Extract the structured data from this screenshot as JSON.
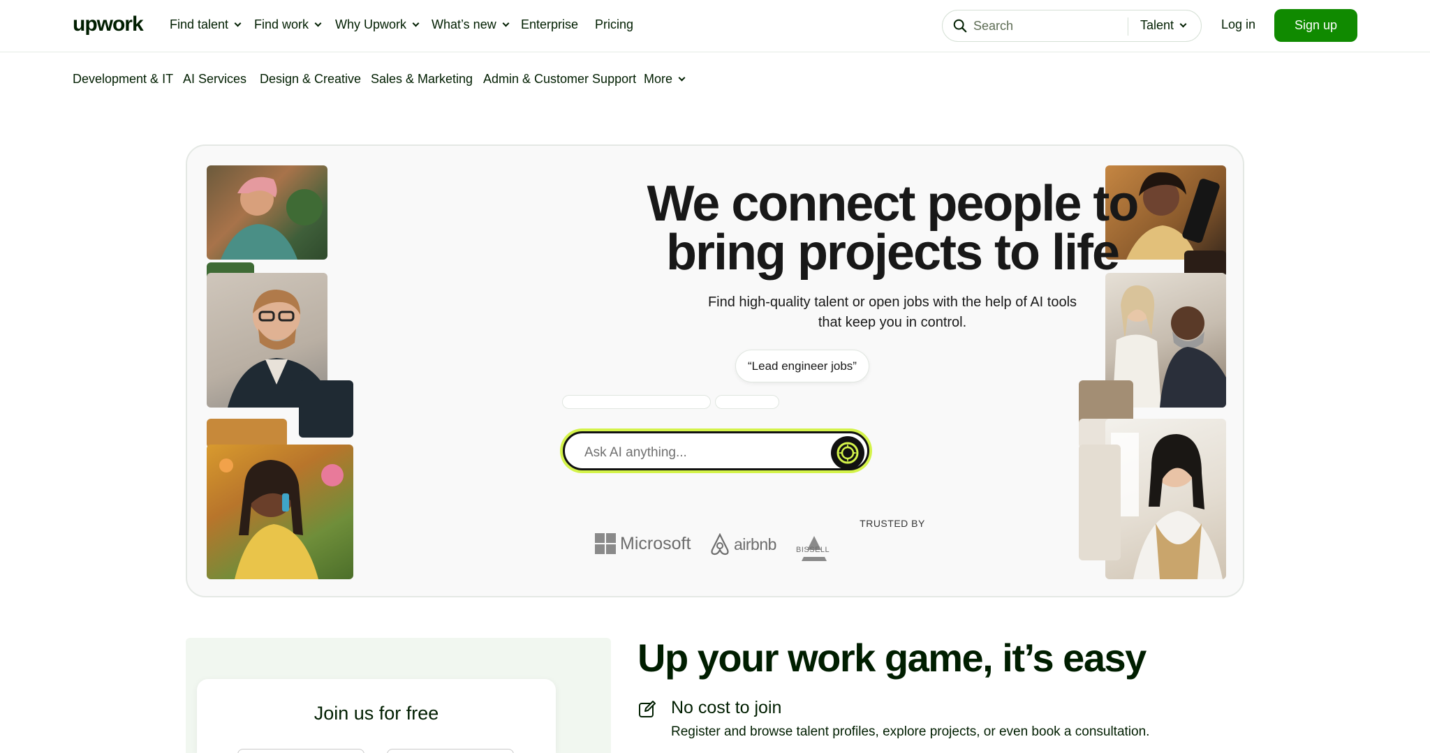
{
  "header": {
    "logo": "upwork",
    "nav": [
      {
        "label": "Find talent",
        "dropdown": true
      },
      {
        "label": "Find work",
        "dropdown": true
      },
      {
        "label": "Why Upwork",
        "dropdown": true
      },
      {
        "label": "What’s new",
        "dropdown": true
      },
      {
        "label": "Enterprise",
        "dropdown": false
      },
      {
        "label": "Pricing",
        "dropdown": false
      }
    ],
    "search": {
      "placeholder": "Search",
      "scope": "Talent"
    },
    "login_label": "Log in",
    "signup_label": "Sign up"
  },
  "categories": [
    {
      "label": "Development & IT"
    },
    {
      "label": "AI Services"
    },
    {
      "label": "Design & Creative"
    },
    {
      "label": "Sales & Marketing"
    },
    {
      "label": "Admin & Customer Support"
    },
    {
      "label": "More",
      "dropdown": true
    }
  ],
  "hero": {
    "title_line1": "We connect people to",
    "title_line2": "bring projects to life",
    "subtitle": "Find high-quality talent or open jobs with the help of AI tools that keep you in control.",
    "prompt_chip": "“Lead engineer jobs”",
    "ai_input_placeholder": "Ask AI anything...",
    "trusted_by": "TRUSTED BY",
    "brands": [
      "Microsoft",
      "airbnb",
      "BISSELL"
    ]
  },
  "join": {
    "title": "Join us for free"
  },
  "easy": {
    "title": "Up your work game, it’s easy",
    "feature_title": "No cost to join",
    "feature_desc": "Register and browse talent profiles, explore projects, or even book a consultation."
  },
  "colors": {
    "brand_green": "#108a00",
    "ai_accent": "#d4f34a",
    "text": "#001e00",
    "join_panel": "#f1f7f0"
  },
  "icons": {
    "search": "search-icon",
    "ai_send": "ai-sparkle-icon",
    "edit": "pencil-square-icon"
  }
}
